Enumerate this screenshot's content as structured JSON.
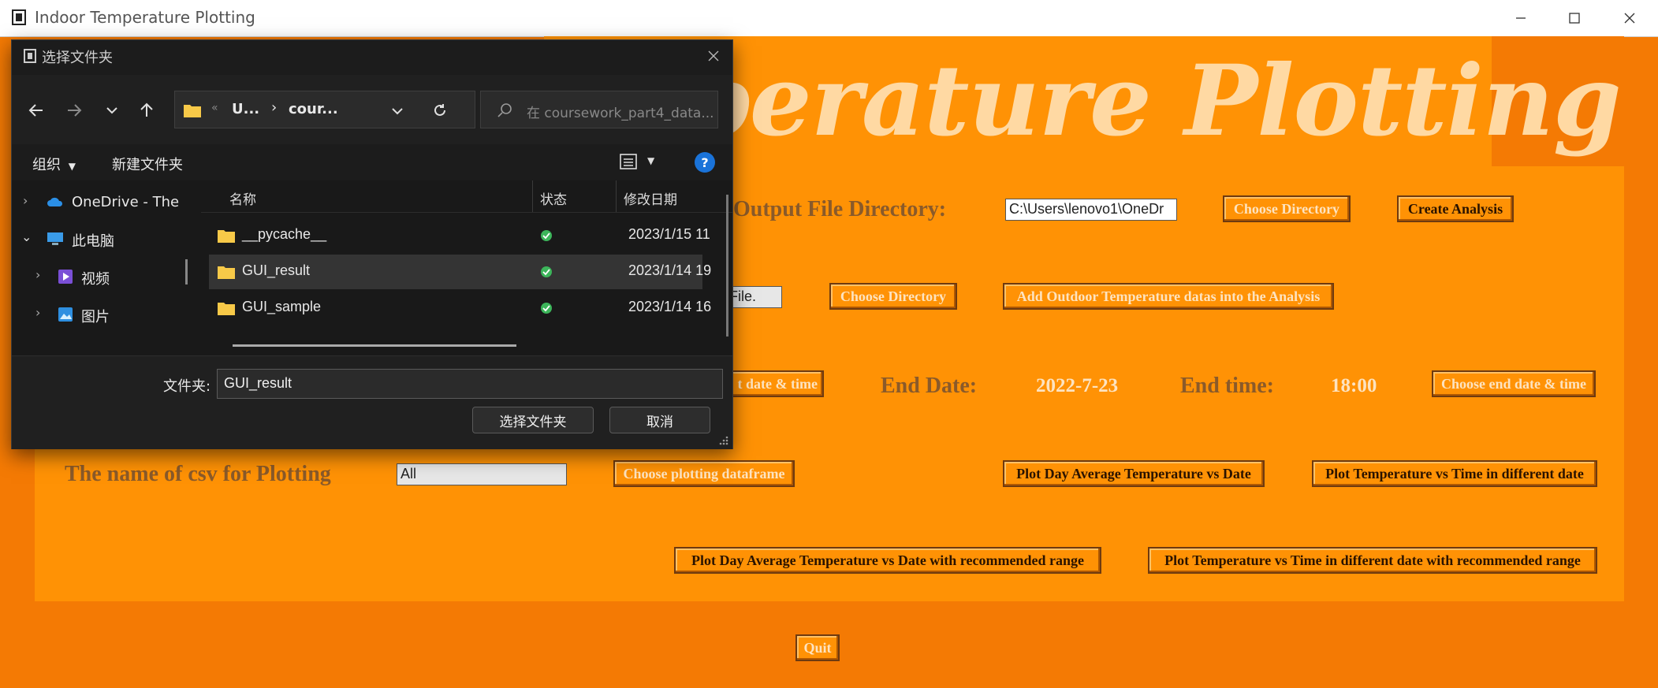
{
  "window": {
    "title": "Indoor Temperature Plotting",
    "minimize_icon": "minimize-icon",
    "maximize_icon": "maximize-icon",
    "close_icon": "close-icon"
  },
  "app": {
    "banner_title": "perature Plotting",
    "output_dir_label": "Output File Directory:",
    "output_dir_value": "C:\\Users\\lenovo1\\OneDr",
    "choose_directory_1": "Choose Directory",
    "create_analysis": "Create Analysis",
    "outdoor_file_value": "File.",
    "choose_directory_2": "Choose Directory",
    "add_outdoor": "Add Outdoor Temperature datas into the Analysis",
    "start_btn_partial": "t date & time",
    "end_date_label": "End Date:",
    "end_date_value": "2022-7-23",
    "end_time_label": "End time:",
    "end_time_value": "18:00",
    "choose_end": "Choose end date & time",
    "csv_label": "The name of csv for Plotting",
    "csv_value": "All",
    "choose_plot_df": "Choose plotting dataframe",
    "plot_day_avg": "Plot Day Average Temperature vs Date",
    "plot_temp_time": "Plot Temperature vs Time in different date",
    "plot_day_avg_range": "Plot Day Average Temperature vs Date with recommended range",
    "plot_temp_time_range": "Plot Temperature vs Time in different date with recommended range",
    "quit": "Quit"
  },
  "dialog": {
    "title": "选择文件夹",
    "address_parts": [
      "U...",
      "cour..."
    ],
    "search_placeholder": "在 coursework_part4_data...",
    "organize": "组织",
    "new_folder": "新建文件夹",
    "columns": [
      "名称",
      "状态",
      "修改日期"
    ],
    "tree": [
      {
        "label": "OneDrive - The",
        "icon": "cloud-icon"
      },
      {
        "label": "此电脑",
        "icon": "computer-icon"
      },
      {
        "label": "视频",
        "icon": "video-icon"
      },
      {
        "label": "图片",
        "icon": "picture-icon"
      }
    ],
    "files": [
      {
        "name": "__pycache__",
        "date": "2023/1/15 11"
      },
      {
        "name": "GUI_result",
        "date": "2023/1/14 19"
      },
      {
        "name": "GUI_sample",
        "date": "2023/1/14 16"
      }
    ],
    "folder_label": "文件夹:",
    "folder_value": "GUI_result",
    "select_button": "选择文件夹",
    "cancel_button": "取消"
  }
}
